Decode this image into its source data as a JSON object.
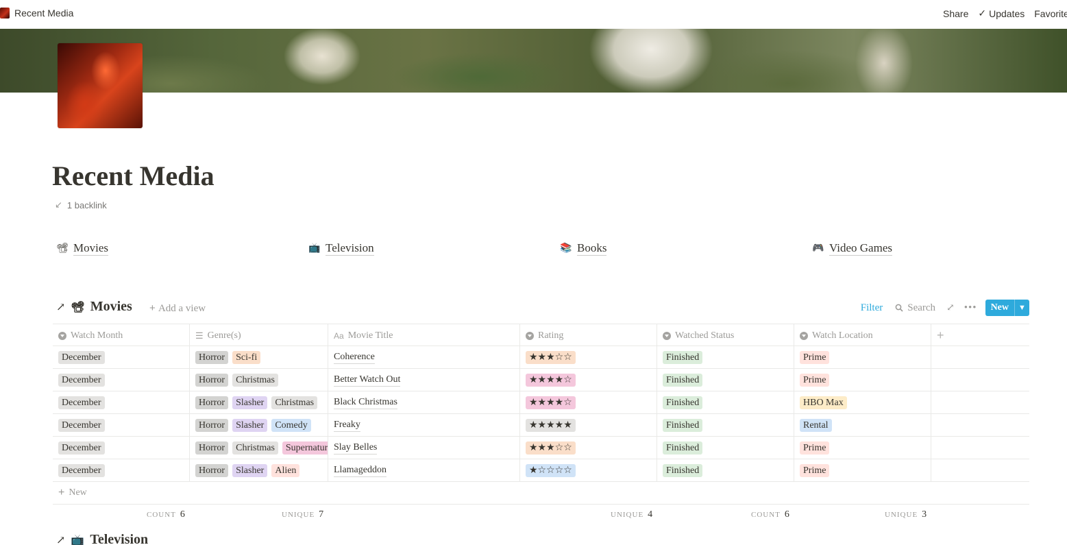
{
  "topbar": {
    "title": "Recent Media",
    "share": "Share",
    "updates": "Updates",
    "favorite": "Favorite"
  },
  "page": {
    "title": "Recent Media",
    "backlink": "1 backlink"
  },
  "links": [
    {
      "icon": "📽",
      "label": "Movies"
    },
    {
      "icon": "📺",
      "label": "Television"
    },
    {
      "icon": "📚",
      "label": "Books"
    },
    {
      "icon": "🎮",
      "label": "Video Games"
    }
  ],
  "movies_db": {
    "icon": "📽",
    "title": "Movies",
    "add_view": "Add a view",
    "filter": "Filter",
    "search": "Search",
    "new": "New",
    "new_row": "New",
    "columns": [
      "Watch Month",
      "Genre(s)",
      "Movie Title",
      "Rating",
      "Watched Status",
      "Watch Location"
    ],
    "rows": [
      {
        "month": "December",
        "genres": [
          "Horror",
          "Sci-fi"
        ],
        "title": "Coherence",
        "rating": "★★★☆☆",
        "status": "Finished",
        "location": "Prime"
      },
      {
        "month": "December",
        "genres": [
          "Horror",
          "Christmas"
        ],
        "title": "Better Watch Out",
        "rating": "★★★★☆",
        "status": "Finished",
        "location": "Prime"
      },
      {
        "month": "December",
        "genres": [
          "Horror",
          "Slasher",
          "Christmas"
        ],
        "title": "Black Christmas",
        "rating": "★★★★☆",
        "status": "Finished",
        "location": "HBO Max"
      },
      {
        "month": "December",
        "genres": [
          "Horror",
          "Slasher",
          "Comedy"
        ],
        "title": "Freaky",
        "rating": "★★★★★",
        "status": "Finished",
        "location": "Rental"
      },
      {
        "month": "December",
        "genres": [
          "Horror",
          "Christmas",
          "Supernatural"
        ],
        "title": "Slay Belles",
        "rating": "★★★☆☆",
        "status": "Finished",
        "location": "Prime"
      },
      {
        "month": "December",
        "genres": [
          "Horror",
          "Slasher",
          "Alien"
        ],
        "title": "Llamageddon",
        "rating": "★☆☆☆☆",
        "status": "Finished",
        "location": "Prime"
      }
    ],
    "calcs": [
      {
        "label": "COUNT",
        "value": "6"
      },
      {
        "label": "UNIQUE",
        "value": "7"
      },
      {
        "label": "UNIQUE",
        "value": "4"
      },
      {
        "label": "COUNT",
        "value": "6"
      },
      {
        "label": "UNIQUE",
        "value": "3"
      }
    ]
  },
  "tv_db": {
    "icon": "📺",
    "title": "Television"
  },
  "colors": {
    "accent": "#2eaadc",
    "text": "#37352f",
    "muted": "#9b9a97"
  }
}
